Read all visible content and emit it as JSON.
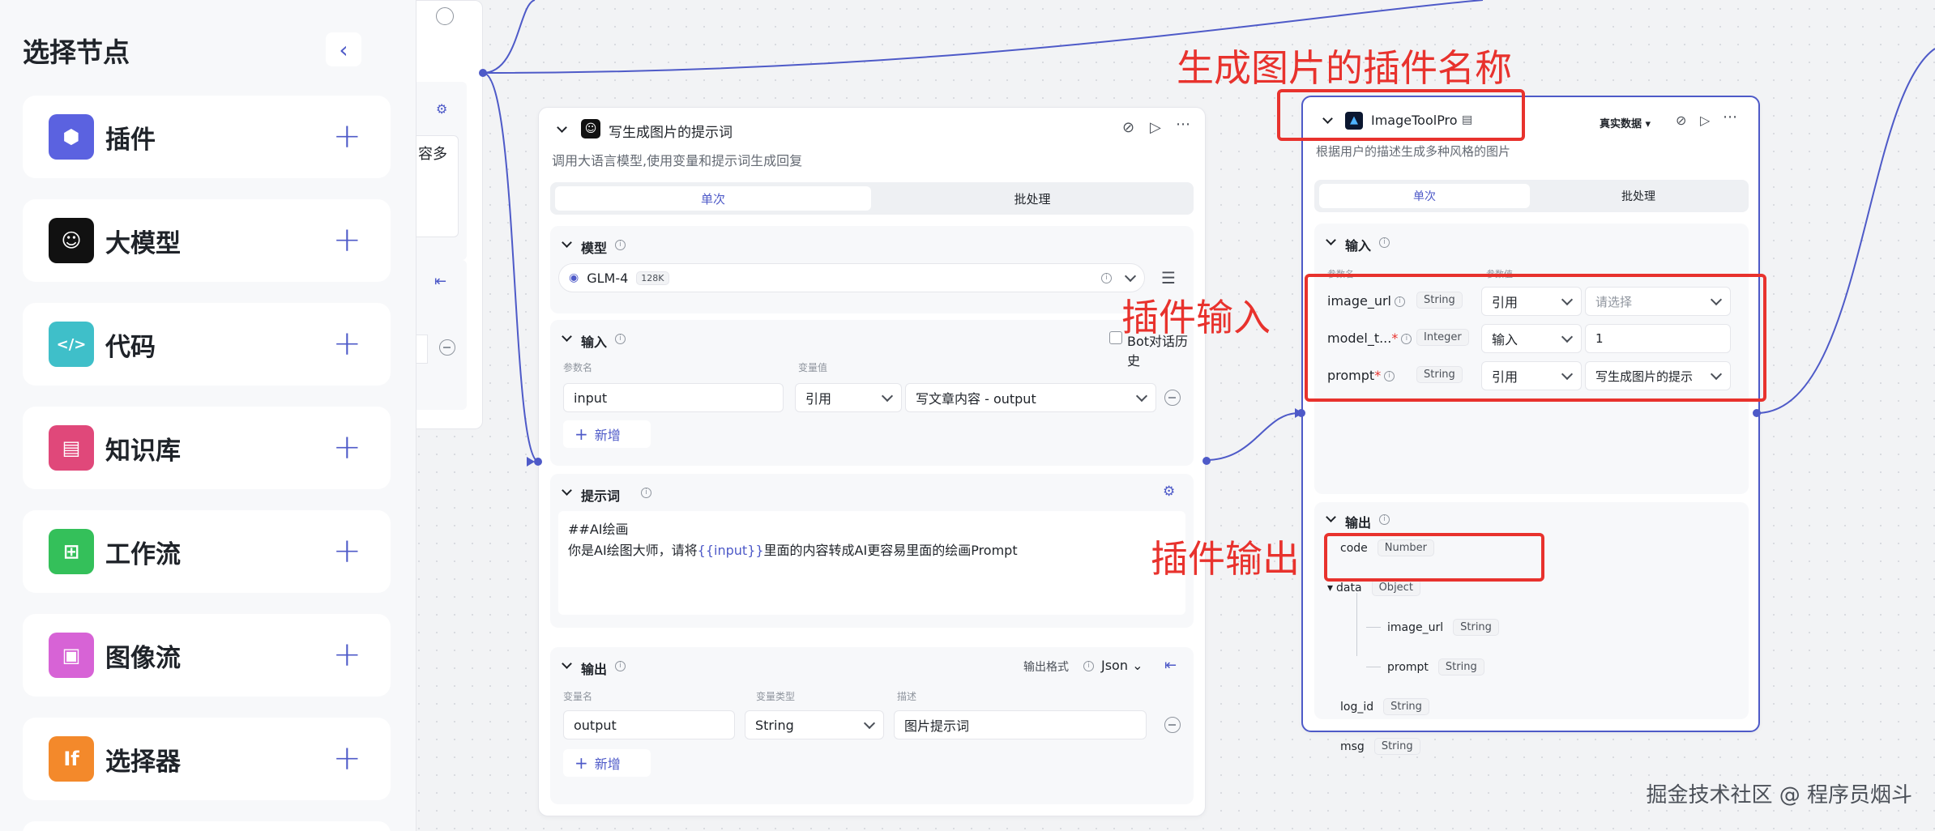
{
  "left_panel": {
    "title": "选择节点",
    "items": [
      {
        "label": "插件",
        "icon": "cube-icon",
        "color": "#5b62e0"
      },
      {
        "label": "大模型",
        "icon": "robot-face-icon",
        "color": "#111111"
      },
      {
        "label": "代码",
        "icon": "code-icon",
        "color": "#3fbfc9"
      },
      {
        "label": "知识库",
        "icon": "book-icon",
        "color": "#e0487a"
      },
      {
        "label": "工作流",
        "icon": "flow-icon",
        "color": "#34c05a"
      },
      {
        "label": "图像流",
        "icon": "image-flow-icon",
        "color": "#d763d6"
      },
      {
        "label": "选择器",
        "icon": "if-icon",
        "color": "#f3892b"
      }
    ]
  },
  "crop_node": {
    "text": "容多"
  },
  "llm_node": {
    "title": "写生成图片的提示词",
    "description": "调用大语言模型,使用变量和提示词生成回复",
    "tabs": [
      "单次",
      "批处理"
    ],
    "model": {
      "section": "模型",
      "name": "GLM-4",
      "context": "128K"
    },
    "input": {
      "section": "输入",
      "history_label": "Bot对话历史",
      "col_param": "参数名",
      "col_value": "变量值",
      "row": {
        "name": "input",
        "mode": "引用",
        "value": "写文章内容 - output"
      },
      "add": "新增"
    },
    "prompt": {
      "section": "提示词",
      "line1": "##AI绘画",
      "line2_pre": "你是AI绘图大师，请将",
      "line2_var": "{{input}}",
      "line2_post": "里面的内容转成AI更容易里面的绘画Prompt"
    },
    "output": {
      "section": "输出",
      "format_label": "输出格式",
      "format_value": "Json",
      "col_name": "变量名",
      "col_type": "变量类型",
      "col_desc": "描述",
      "row": {
        "name": "output",
        "type": "String",
        "desc": "图片提示词"
      },
      "add": "新增"
    }
  },
  "plugin_node": {
    "title": "ImageToolPro",
    "test_data": "真实数据",
    "description": "根据用户的描述生成多种风格的图片",
    "tabs": [
      "单次",
      "批处理"
    ],
    "input": {
      "section": "输入",
      "col_param": "参数名",
      "col_value": "参数值",
      "rows": [
        {
          "name": "image_url",
          "type": "String",
          "mode": "引用",
          "value": "请选择",
          "required": false,
          "placeholder": true
        },
        {
          "name": "model_t...",
          "type": "Integer",
          "mode": "输入",
          "value": "1",
          "required": true,
          "placeholder": false
        },
        {
          "name": "prompt",
          "type": "String",
          "mode": "引用",
          "value": "写生成图片的提示",
          "required": true,
          "placeholder": false
        }
      ]
    },
    "output": {
      "section": "输出",
      "items": [
        {
          "name": "code",
          "type": "Number"
        },
        {
          "name": "data",
          "type": "Object"
        },
        {
          "name": "image_url",
          "type": "String"
        },
        {
          "name": "prompt",
          "type": "String"
        },
        {
          "name": "log_id",
          "type": "String"
        },
        {
          "name": "msg",
          "type": "String"
        }
      ]
    }
  },
  "annotations": {
    "plugin_name": "生成图片的插件名称",
    "plugin_input": "插件输入",
    "plugin_output": "插件输出"
  },
  "watermark": "掘金技术社区 @ 程序员烟斗",
  "colors": {
    "accent": "#4e5ac8",
    "annotation": "#e8322d"
  }
}
